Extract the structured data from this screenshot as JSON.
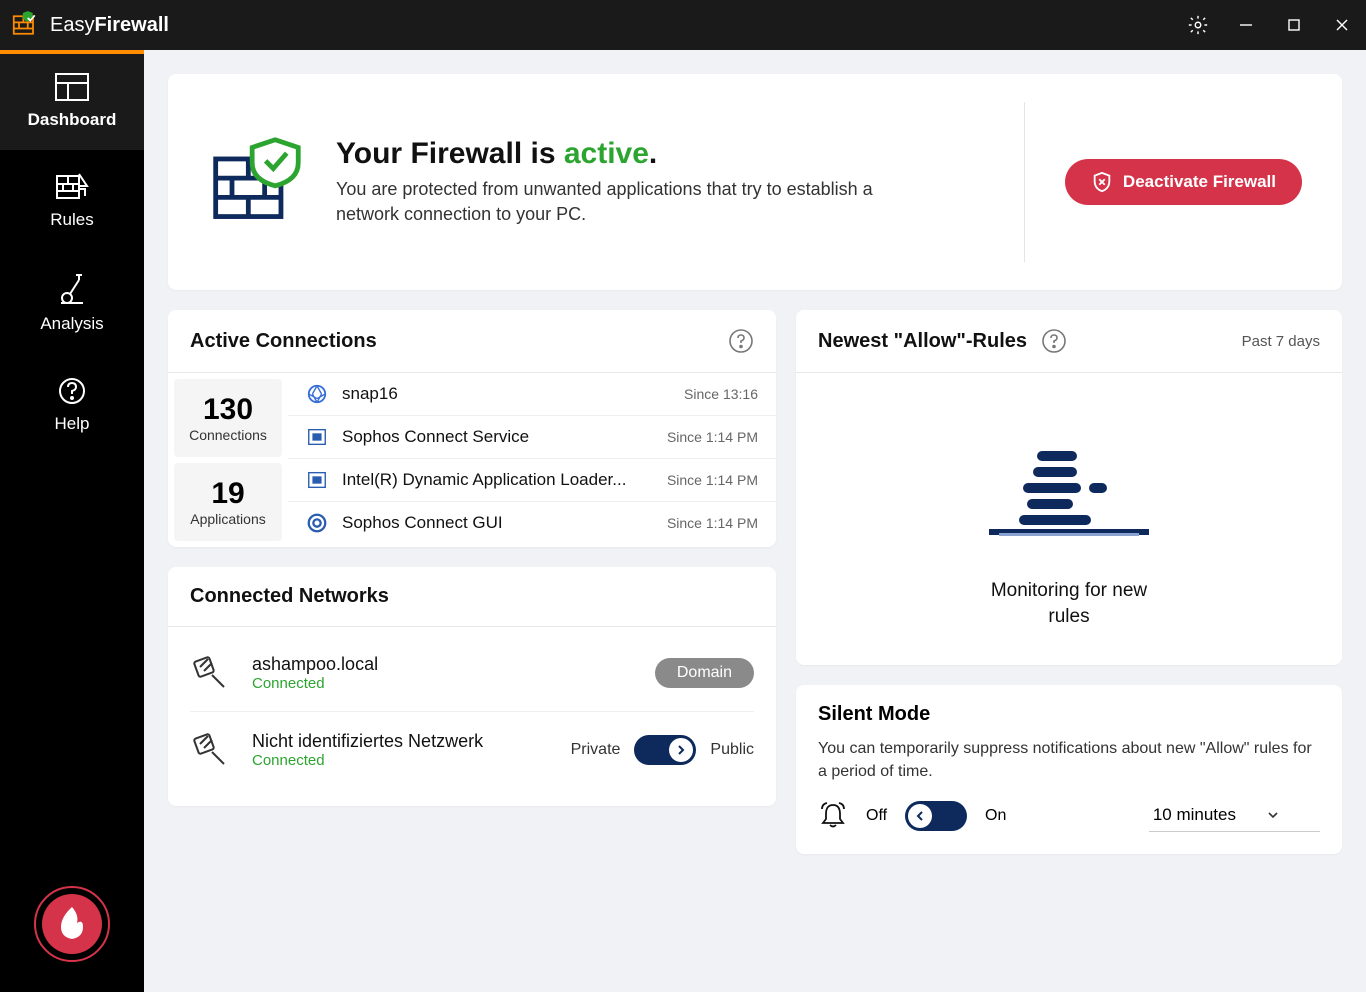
{
  "app": {
    "title_light": "Easy",
    "title_bold": "Firewall"
  },
  "sidebar": {
    "items": [
      {
        "label": "Dashboard"
      },
      {
        "label": "Rules"
      },
      {
        "label": "Analysis"
      },
      {
        "label": "Help"
      }
    ]
  },
  "hero": {
    "title_prefix": "Your Firewall is ",
    "title_status": "active",
    "title_suffix": ".",
    "subtitle": "You are protected from unwanted applications that try to establish a network connection to your PC.",
    "deactivate_label": "Deactivate Firewall"
  },
  "active_connections": {
    "title": "Active Connections",
    "count_connections": "130",
    "count_connections_label": "Connections",
    "count_apps": "19",
    "count_apps_label": "Applications",
    "items": [
      {
        "name": "snap16",
        "since": "Since 13:16",
        "icon": "aperture"
      },
      {
        "name": "Sophos Connect Service",
        "since": "Since 1:14 PM",
        "icon": "window"
      },
      {
        "name": "Intel(R) Dynamic Application Loader...",
        "since": "Since 1:14 PM",
        "icon": "window"
      },
      {
        "name": "Sophos Connect GUI",
        "since": "Since 1:14 PM",
        "icon": "target"
      }
    ]
  },
  "connected_networks": {
    "title": "Connected Networks",
    "items": [
      {
        "name": "ashampoo.local",
        "status": "Connected",
        "type": "domain",
        "badge": "Domain"
      },
      {
        "name": "Nicht identifiziertes Netzwerk",
        "status": "Connected",
        "type": "toggle",
        "left": "Private",
        "right": "Public"
      }
    ]
  },
  "allow_rules": {
    "title": "Newest \"Allow\"-Rules",
    "range": "Past 7 days",
    "message": "Monitoring for new rules"
  },
  "silent_mode": {
    "title": "Silent Mode",
    "description": "You can temporarily suppress notifications about new \"Allow\" rules for a period of time.",
    "off_label": "Off",
    "on_label": "On",
    "duration": "10 minutes"
  }
}
